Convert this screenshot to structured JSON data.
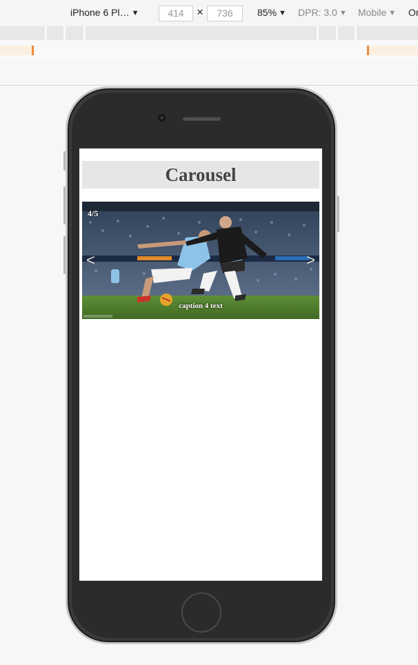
{
  "devtools": {
    "device": "iPhone 6 Pl…",
    "width": "414",
    "times": "×",
    "height": "736",
    "zoom": "85%",
    "dpr": "DPR: 3.0",
    "mode": "Mobile",
    "overflow_label": "Or"
  },
  "page": {
    "title": "Carousel"
  },
  "carousel": {
    "counter": "4/5",
    "prev_arrow": "<",
    "next_arrow": ">",
    "caption": "caption 4 text",
    "current_slide": 4,
    "total_slides": 5
  },
  "colors": {
    "header_bg": "#e6e6e6",
    "title_text": "#444444",
    "phone_body": "#2b2b2b",
    "pitch_green": "#4f7c2e",
    "home_kit": "#8ec3e8",
    "away_kit": "#1b1b1b",
    "media_query_marker": "#f08a3a"
  }
}
